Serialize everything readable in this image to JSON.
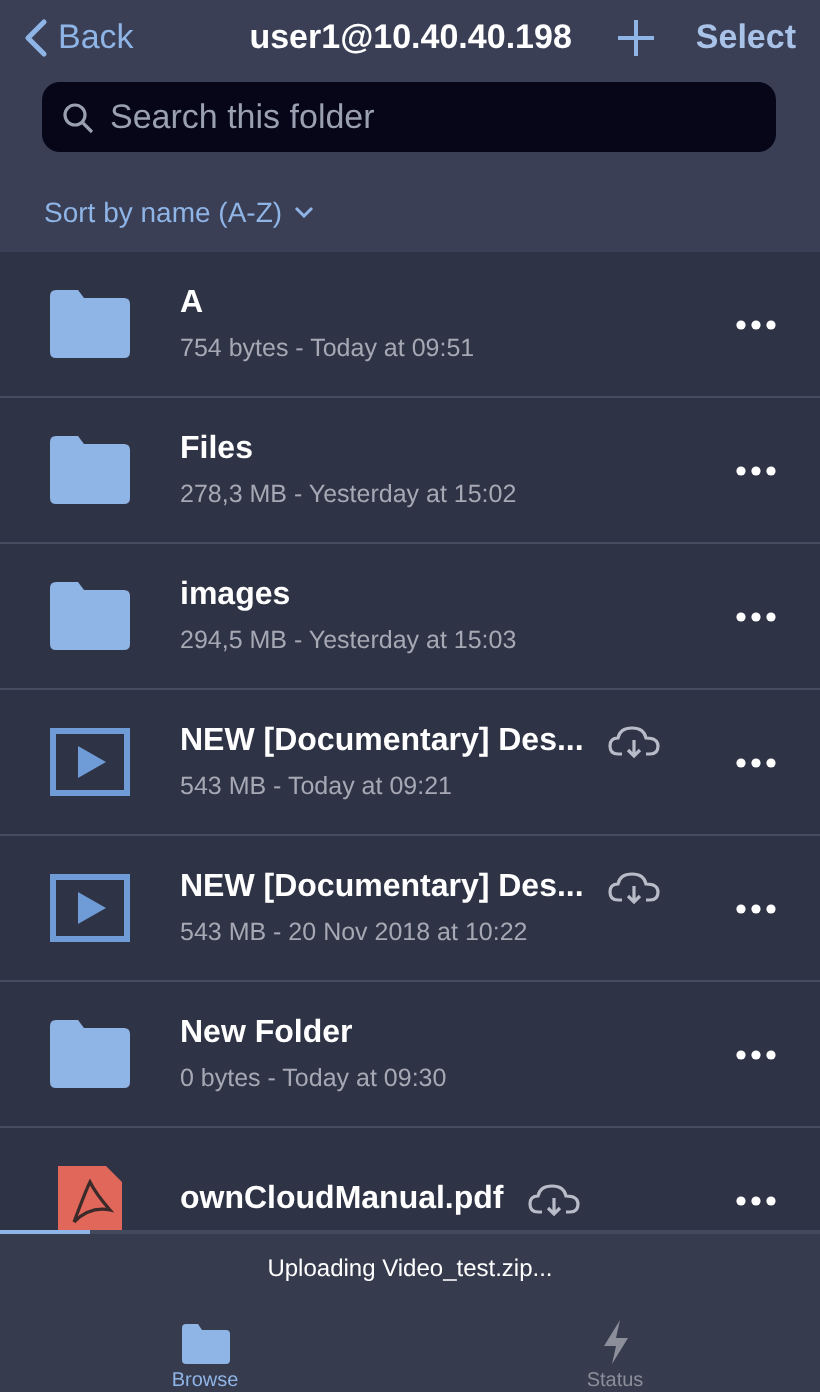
{
  "nav": {
    "back": "Back",
    "title": "user1@10.40.40.198",
    "select": "Select"
  },
  "search": {
    "placeholder": "Search this folder"
  },
  "sort": {
    "label": "Sort by name (A-Z)"
  },
  "items": [
    {
      "kind": "folder",
      "name": "A",
      "meta": "754 bytes - Today at 09:51",
      "cloud": false
    },
    {
      "kind": "folder",
      "name": "Files",
      "meta": "278,3 MB - Yesterday at 15:02",
      "cloud": false
    },
    {
      "kind": "folder",
      "name": "images",
      "meta": "294,5 MB - Yesterday at 15:03",
      "cloud": false
    },
    {
      "kind": "video",
      "name": "NEW [Documentary] Des...",
      "meta": "543 MB - Today at 09:21",
      "cloud": true
    },
    {
      "kind": "video",
      "name": "NEW [Documentary] Des...",
      "meta": "543 MB - 20 Nov 2018 at 10:22",
      "cloud": true
    },
    {
      "kind": "folder",
      "name": "New Folder",
      "meta": "0 bytes - Today at 09:30",
      "cloud": false
    },
    {
      "kind": "pdf",
      "name": "ownCloudManual.pdf",
      "cloud": true
    }
  ],
  "upload": {
    "text": "Uploading Video_test.zip...",
    "level": 0.11
  },
  "tabs": [
    {
      "label": "Browse",
      "kind": "browse",
      "selected": true
    },
    {
      "label": "Status",
      "kind": "status",
      "selected": false
    }
  ]
}
